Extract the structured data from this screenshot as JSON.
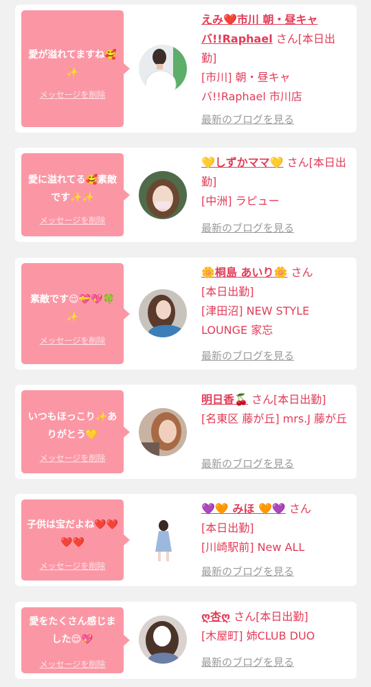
{
  "common": {
    "delete_label": "メッセージを削除",
    "blog_label": "最新のブログを見る",
    "san_suffix": " さん",
    "colors": {
      "bubble": "#fb97a5",
      "accent": "#e23b57",
      "link_gray": "#9a9a9a",
      "background": "#f1f1f1"
    }
  },
  "messages": [
    {
      "message": "愛が溢れてますね🥰✨",
      "name": "えみ❤️市川 朝・昼キャバ!!Raphael",
      "status": "[本日出勤]",
      "shop": "[市川] 朝・昼キャバ!!Raphael 市川店"
    },
    {
      "message": "愛に溢れてる🥰素敵です✨✨",
      "name": "💛しずかママ💛",
      "status": "[本日出勤]",
      "shop": "[中洲] ラピュー"
    },
    {
      "message": "素敵です😌💝💖🍀✨",
      "name": "🌼桐島 あいり🌼",
      "status": "[本日出勤]",
      "shop": "[津田沼] NEW STYLE LOUNGE 家忘"
    },
    {
      "message": "いつもほっこり✨ありがとう💛",
      "name": "明日香🍒",
      "status": "[本日出勤]",
      "shop": "[名東区 藤が丘] mrs.J 藤が丘"
    },
    {
      "message": "子供は宝だよね❤️❤️❤️❤️",
      "name": "💜🧡 みほ 🧡💜",
      "status": "[本日出勤]",
      "shop": "[川崎駅前] New ALL"
    },
    {
      "message": "愛をたくさん感じました😌💖",
      "name": "ღ杏ღ",
      "status": "[本日出勤]",
      "shop": "[木屋町] 姉CLUB DUO"
    }
  ]
}
